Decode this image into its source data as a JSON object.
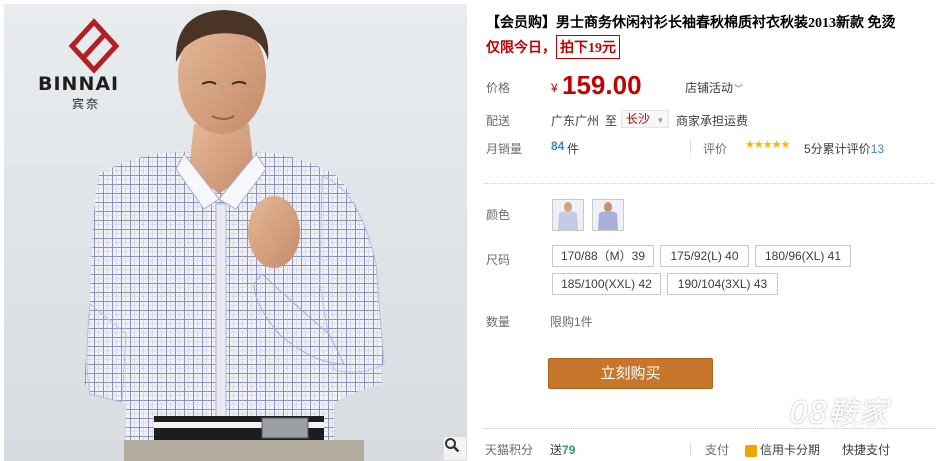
{
  "brand": {
    "logo_text": "BINNAI",
    "logo_cn": "宾奈"
  },
  "product": {
    "title": "【会员购】男士商务休闲衬衫长袖春秋棉质衬衣秋装2013新款 免烫",
    "promo_prefix": "仅限今日，",
    "promo_boxed": "拍下19元"
  },
  "price": {
    "label": "价格",
    "currency": "¥",
    "value": "159.00",
    "store_activity": "店铺活动"
  },
  "delivery": {
    "label": "配送",
    "from": "广东广州",
    "to_word": "至",
    "city": "长沙",
    "shipping": "商家承担运费"
  },
  "sales": {
    "label": "月销量",
    "count": "84",
    "unit": "件",
    "rating_label": "评价",
    "stars": "★★★★★",
    "rating_text": "5分累计评价",
    "rating_count": "13"
  },
  "color": {
    "label": "颜色"
  },
  "size": {
    "label": "尺码",
    "options": [
      "170/88（M）39",
      "175/92(L) 40",
      "180/96(XL) 41",
      "185/100(XXL) 42",
      "190/104(3XL) 43"
    ]
  },
  "quantity": {
    "label": "数量",
    "limit": "限购1件"
  },
  "buy_button": "立刻购买",
  "bottom": {
    "points_label": "天猫积分",
    "points_prefix": "送",
    "points_value": "79",
    "pay_label": "支付",
    "pay_credit": "信用卡分期",
    "pay_quick": "快捷支付"
  },
  "watermark": "08鞍家",
  "colors": {
    "price_red": "#c40000",
    "buy_button": "#c8762c",
    "link_blue": "#3c88c2",
    "star": "#ffb400"
  }
}
